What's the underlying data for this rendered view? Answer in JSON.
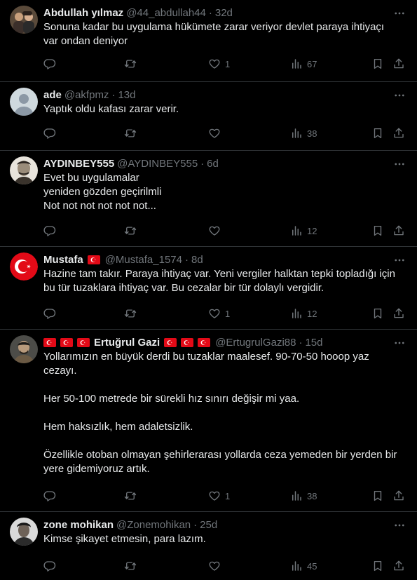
{
  "tweets": [
    {
      "name": "Abdullah yılmaz",
      "handle": "@44_abdullah44",
      "age": "32d",
      "text": "Sonuna kadar bu uygulama hükümete zarar veriyor devlet paraya ihtiyaçı\nvar ondan deniyor",
      "likes": "1",
      "views": "67"
    },
    {
      "name": "ade",
      "handle": "@akfpmz",
      "age": "13d",
      "text": "Yaptık oldu kafası zarar verir.",
      "likes": "",
      "views": "38"
    },
    {
      "name": "AYDINBEY555",
      "handle": "@AYDINBEY555",
      "age": "6d",
      "text": "Evet bu uygulamalar\nyeniden gözden geçirilmli\nNot not not not not not...",
      "likes": "",
      "views": "12"
    },
    {
      "name": "Mustafa",
      "handle": "@Mustafa_1574",
      "age": "8d",
      "text": "Hazine tam takır. Paraya ihtiyaç var. Yeni vergiler halktan tepki topladığı için\nbu tür tuzaklara ihtiyaç var. Bu cezalar bir tür dolaylı vergidir.",
      "likes": "1",
      "views": "12"
    },
    {
      "name": "Ertuğrul Gazi",
      "handle": "@ErtugrulGazi88",
      "age": "15d",
      "text": "Yollarımızın en büyük derdi bu tuzaklar maalesef. 90-70-50 hooop yaz\ncezayı.\n\nHer 50-100 metrede bir sürekli hız sınırı değişir mi yaa.\n\nHem haksızlık, hem adaletsizlik.\n\nÖzellikle otoban olmayan şehirlerarası yollarda ceza yemeden bir yerden bir\nyere gidemiyoruz artık.",
      "likes": "1",
      "views": "38"
    },
    {
      "name": "zone mohikan",
      "handle": "@Zonemohikan",
      "age": "25d",
      "text": "Kimse şikayet etmesin, para lazım.",
      "likes": "",
      "views": "45"
    }
  ],
  "separator": "·",
  "colors": {
    "background": "#000000",
    "text": "#e7e9ea",
    "muted": "#71767b",
    "border": "#2f3336",
    "flag_red": "#e30a17"
  },
  "icons": [
    "more-icon",
    "reply-icon",
    "retweet-icon",
    "like-icon",
    "views-icon",
    "bookmark-icon",
    "share-icon"
  ]
}
